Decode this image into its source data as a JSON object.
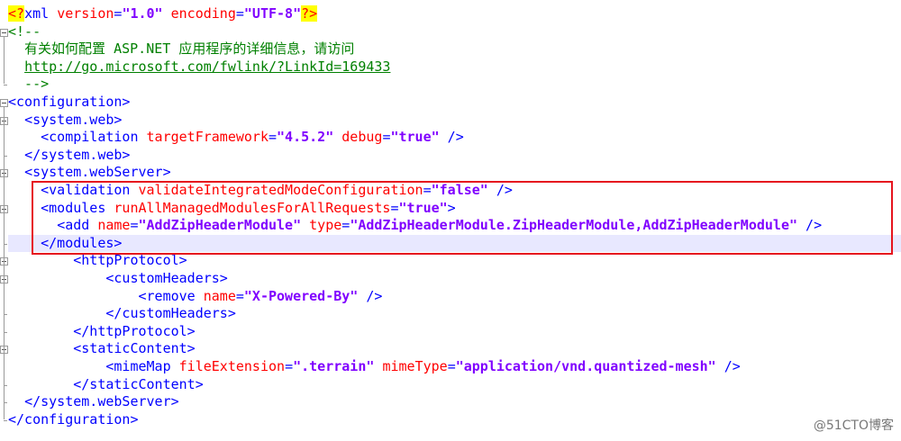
{
  "editor": {
    "lines": [
      {
        "tokens": [
          [
            "pi",
            "<?"
          ],
          [
            "b",
            "xml "
          ],
          [
            "a",
            "version"
          ],
          [
            "b",
            "="
          ],
          [
            "v",
            "\"1.0\""
          ],
          [
            "b",
            " "
          ],
          [
            "a",
            "encoding"
          ],
          [
            "b",
            "="
          ],
          [
            "v",
            "\"UTF-8\""
          ],
          [
            "pi",
            "?>"
          ]
        ]
      },
      {
        "tokens": [
          [
            "c",
            "<!--"
          ]
        ]
      },
      {
        "tokens": [
          [
            "c",
            "  有关如何配置 ASP.NET 应用程序的详细信息，请访问"
          ]
        ]
      },
      {
        "tokens": [
          [
            "c",
            "  "
          ],
          [
            "u",
            "http://go.microsoft.com/fwlink/?LinkId=169433"
          ]
        ]
      },
      {
        "tokens": [
          [
            "c",
            "  -->"
          ]
        ]
      },
      {
        "tokens": [
          [
            "b",
            "<configuration>"
          ]
        ]
      },
      {
        "tokens": [
          [
            "t",
            "  "
          ],
          [
            "b",
            "<system.web>"
          ]
        ]
      },
      {
        "tokens": [
          [
            "t",
            "    "
          ],
          [
            "b",
            "<compilation "
          ],
          [
            "a",
            "targetFramework"
          ],
          [
            "b",
            "="
          ],
          [
            "v",
            "\"4.5.2\""
          ],
          [
            "b",
            " "
          ],
          [
            "a",
            "debug"
          ],
          [
            "b",
            "="
          ],
          [
            "v",
            "\"true\""
          ],
          [
            "b",
            " />"
          ]
        ]
      },
      {
        "tokens": [
          [
            "t",
            "  "
          ],
          [
            "b",
            "</system.web>"
          ]
        ]
      },
      {
        "tokens": [
          [
            "t",
            "  "
          ],
          [
            "b",
            "<system.webServer>"
          ]
        ]
      },
      {
        "tokens": [
          [
            "t",
            "    "
          ],
          [
            "b",
            "<validation "
          ],
          [
            "a",
            "validateIntegratedModeConfiguration"
          ],
          [
            "b",
            "="
          ],
          [
            "v",
            "\"false\""
          ],
          [
            "b",
            " />"
          ]
        ]
      },
      {
        "tokens": [
          [
            "t",
            "    "
          ],
          [
            "b",
            "<modules "
          ],
          [
            "a",
            "runAllManagedModulesForAllRequests"
          ],
          [
            "b",
            "="
          ],
          [
            "v",
            "\"true\""
          ],
          [
            "b",
            ">"
          ]
        ]
      },
      {
        "tokens": [
          [
            "t",
            "      "
          ],
          [
            "b",
            "<add "
          ],
          [
            "a",
            "name"
          ],
          [
            "b",
            "="
          ],
          [
            "v",
            "\"AddZipHeaderModule\""
          ],
          [
            "b",
            " "
          ],
          [
            "a",
            "type"
          ],
          [
            "b",
            "="
          ],
          [
            "v",
            "\"AddZipHeaderModule.ZipHeaderModule,AddZipHeaderModule\""
          ],
          [
            "b",
            " />"
          ]
        ]
      },
      {
        "tokens": [
          [
            "t",
            "    "
          ],
          [
            "b",
            "</modules>"
          ]
        ]
      },
      {
        "tokens": [
          [
            "t",
            "        "
          ],
          [
            "b",
            "<httpProtocol>"
          ]
        ]
      },
      {
        "tokens": [
          [
            "t",
            "            "
          ],
          [
            "b",
            "<customHeaders>"
          ]
        ]
      },
      {
        "tokens": [
          [
            "t",
            "                "
          ],
          [
            "b",
            "<remove "
          ],
          [
            "a",
            "name"
          ],
          [
            "b",
            "="
          ],
          [
            "v",
            "\"X-Powered-By\""
          ],
          [
            "b",
            " />"
          ]
        ]
      },
      {
        "tokens": [
          [
            "t",
            "            "
          ],
          [
            "b",
            "</customHeaders>"
          ]
        ]
      },
      {
        "tokens": [
          [
            "t",
            "        "
          ],
          [
            "b",
            "</httpProtocol>"
          ]
        ]
      },
      {
        "tokens": [
          [
            "t",
            "        "
          ],
          [
            "b",
            "<staticContent>"
          ]
        ]
      },
      {
        "tokens": [
          [
            "t",
            "            "
          ],
          [
            "b",
            "<mimeMap "
          ],
          [
            "a",
            "fileExtension"
          ],
          [
            "b",
            "="
          ],
          [
            "v",
            "\".terrain\""
          ],
          [
            "b",
            " "
          ],
          [
            "a",
            "mimeType"
          ],
          [
            "b",
            "="
          ],
          [
            "v",
            "\"application/vnd.quantized-mesh\""
          ],
          [
            "b",
            " />"
          ]
        ]
      },
      {
        "tokens": [
          [
            "t",
            "        "
          ],
          [
            "b",
            "</staticContent>"
          ]
        ]
      },
      {
        "tokens": [
          [
            "t",
            "  "
          ],
          [
            "b",
            "</system.webServer>"
          ]
        ]
      },
      {
        "tokens": [
          [
            "b",
            "</configuration>"
          ]
        ]
      }
    ],
    "highlighted_line": 13
  },
  "watermark": "@51CTO博客"
}
